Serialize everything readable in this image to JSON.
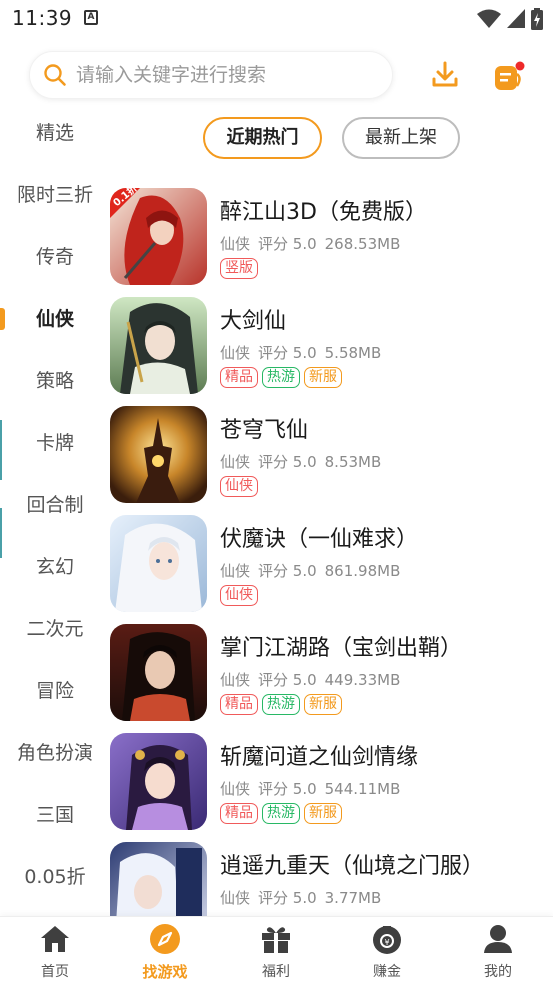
{
  "status_bar": {
    "time": "11:39",
    "notif_icon": "A"
  },
  "search": {
    "placeholder": "请输入关键字进行搜索"
  },
  "header_icons": {
    "download": "download-icon",
    "message": "message-icon",
    "accent": "#f39a1e"
  },
  "sort_tabs": [
    {
      "label": "近期热门",
      "active": true
    },
    {
      "label": "最新上架",
      "active": false
    }
  ],
  "sidebar": {
    "items": [
      {
        "label": "精选"
      },
      {
        "label": "限时三折"
      },
      {
        "label": "传奇"
      },
      {
        "label": "仙侠",
        "active": true
      },
      {
        "label": "策略"
      },
      {
        "label": "卡牌"
      },
      {
        "label": "回合制"
      },
      {
        "label": "玄幻"
      },
      {
        "label": "二次元"
      },
      {
        "label": "冒险"
      },
      {
        "label": "角色扮演"
      },
      {
        "label": "三国"
      },
      {
        "label": "0.05折"
      }
    ]
  },
  "games": [
    {
      "name": "醉江山3D（免费版）",
      "category": "仙侠",
      "rating": "评分 5.0",
      "size": "268.53MB",
      "tags": [
        {
          "text": "竖版",
          "color": "red"
        }
      ],
      "badge": "0.1折"
    },
    {
      "name": "大剑仙",
      "category": "仙侠",
      "rating": "评分 5.0",
      "size": "5.58MB",
      "tags": [
        {
          "text": "精品",
          "color": "red"
        },
        {
          "text": "热游",
          "color": "green"
        },
        {
          "text": "新服",
          "color": "orange"
        }
      ]
    },
    {
      "name": "苍穹飞仙",
      "category": "仙侠",
      "rating": "评分 5.0",
      "size": "8.53MB",
      "tags": [
        {
          "text": "仙侠",
          "color": "red"
        }
      ]
    },
    {
      "name": "伏魔诀（一仙难求）",
      "category": "仙侠",
      "rating": "评分 5.0",
      "size": "861.98MB",
      "tags": [
        {
          "text": "仙侠",
          "color": "red"
        }
      ]
    },
    {
      "name": "掌门江湖路（宝剑出鞘）",
      "category": "仙侠",
      "rating": "评分 5.0",
      "size": "449.33MB",
      "tags": [
        {
          "text": "精品",
          "color": "red"
        },
        {
          "text": "热游",
          "color": "green"
        },
        {
          "text": "新服",
          "color": "orange"
        }
      ]
    },
    {
      "name": "斩魔问道之仙剑情缘",
      "category": "仙侠",
      "rating": "评分 5.0",
      "size": "544.11MB",
      "tags": [
        {
          "text": "精品",
          "color": "red"
        },
        {
          "text": "热游",
          "color": "green"
        },
        {
          "text": "新服",
          "color": "orange"
        }
      ]
    },
    {
      "name": "逍遥九重天（仙境之门服）",
      "category": "仙侠",
      "rating": "评分 5.0",
      "size": "3.77MB",
      "tags": []
    }
  ],
  "bottom_nav": [
    {
      "label": "首页",
      "icon": "home-icon"
    },
    {
      "label": "找游戏",
      "icon": "compass-icon",
      "active": true
    },
    {
      "label": "福利",
      "icon": "gift-icon"
    },
    {
      "label": "赚金",
      "icon": "coin-bag-icon"
    },
    {
      "label": "我的",
      "icon": "user-icon"
    }
  ]
}
